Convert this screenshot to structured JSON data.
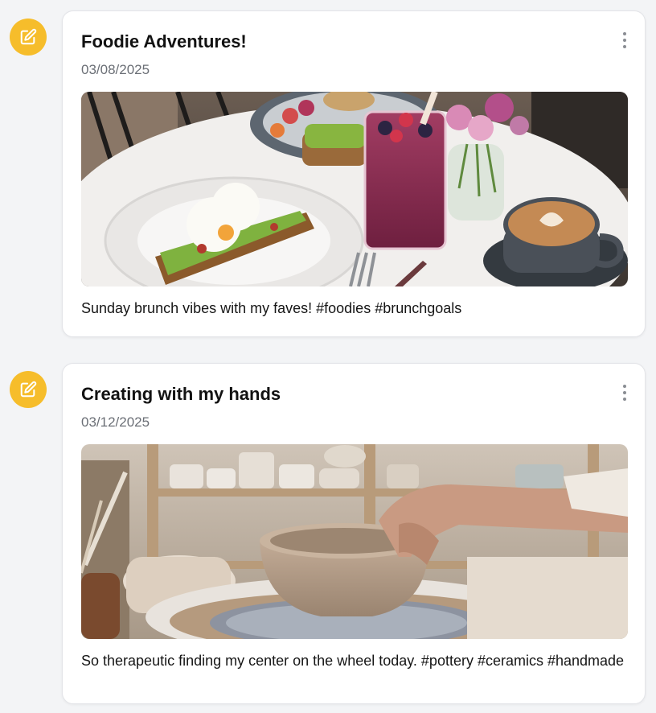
{
  "posts": [
    {
      "title": "Foodie Adventures!",
      "date": "03/08/2025",
      "caption": "Sunday brunch vibes with my faves! #foodies #brunchgoals",
      "image_description": "brunch-table-photo"
    },
    {
      "title": "Creating with my hands",
      "date": "03/12/2025",
      "caption": "So therapeutic finding my center on the wheel today. #pottery #ceramics #handmade",
      "image_description": "pottery-wheel-photo"
    }
  ],
  "colors": {
    "edit_badge": "#f6bd2b",
    "background": "#f3f4f6",
    "card": "#ffffff"
  },
  "icons": {
    "edit": "pencil-square-icon",
    "menu": "more-vertical-icon"
  }
}
